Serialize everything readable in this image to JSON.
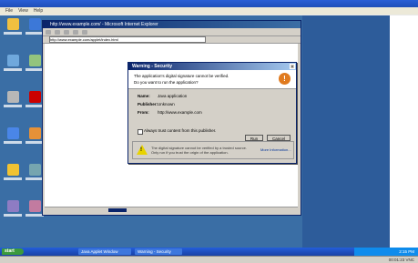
{
  "host": {
    "menu": [
      "File",
      "View",
      "Help"
    ],
    "status_right": "00:01:23  VNC"
  },
  "desktop_icons": [
    {
      "name": "my-documents",
      "color": "#f0c040"
    },
    {
      "name": "internet-explorer",
      "color": "#3c78d8"
    },
    {
      "name": "my-computer",
      "color": "#6fa8dc"
    },
    {
      "name": "my-network-places",
      "color": "#93c47d"
    },
    {
      "name": "recycle-bin",
      "color": "#b7b7b7"
    },
    {
      "name": "acrobat-reader",
      "color": "#cc0000"
    },
    {
      "name": "outlook-express",
      "color": "#4a86e8"
    },
    {
      "name": "app-shortcut",
      "color": "#e69138"
    },
    {
      "name": "folder",
      "color": "#f1c232"
    },
    {
      "name": "shortcut-2",
      "color": "#76a5af"
    },
    {
      "name": "shortcut-3",
      "color": "#8e7cc3"
    },
    {
      "name": "shortcut-4",
      "color": "#c27ba0"
    }
  ],
  "browser": {
    "title": "http://www.example.com/ - Microsoft Internet Explorer",
    "address": "http://www.example.com/applet/index.html",
    "go_label": "Go"
  },
  "dialog": {
    "title": "Warning - Security",
    "heading": "The application's digital signature cannot be verified.",
    "subheading": "Do you want to run the application?",
    "rows": [
      {
        "label": "Name:",
        "value": "Java application"
      },
      {
        "label": "Publisher:",
        "value": "Unknown"
      },
      {
        "label": "From:",
        "value": "http://www.example.com"
      }
    ],
    "checkbox_label": "Always trust content from this publisher.",
    "run_label": "Run",
    "cancel_label": "Cancel",
    "footer_text": "The digital signature cannot be verified by a trusted source. Only run if you trust the origin of the application.",
    "more_info": "More Information..."
  },
  "taskbar": {
    "start": "start",
    "tasks": [
      "Java Applet Window",
      "Warning - Security"
    ],
    "clock": "2:15 PM"
  }
}
